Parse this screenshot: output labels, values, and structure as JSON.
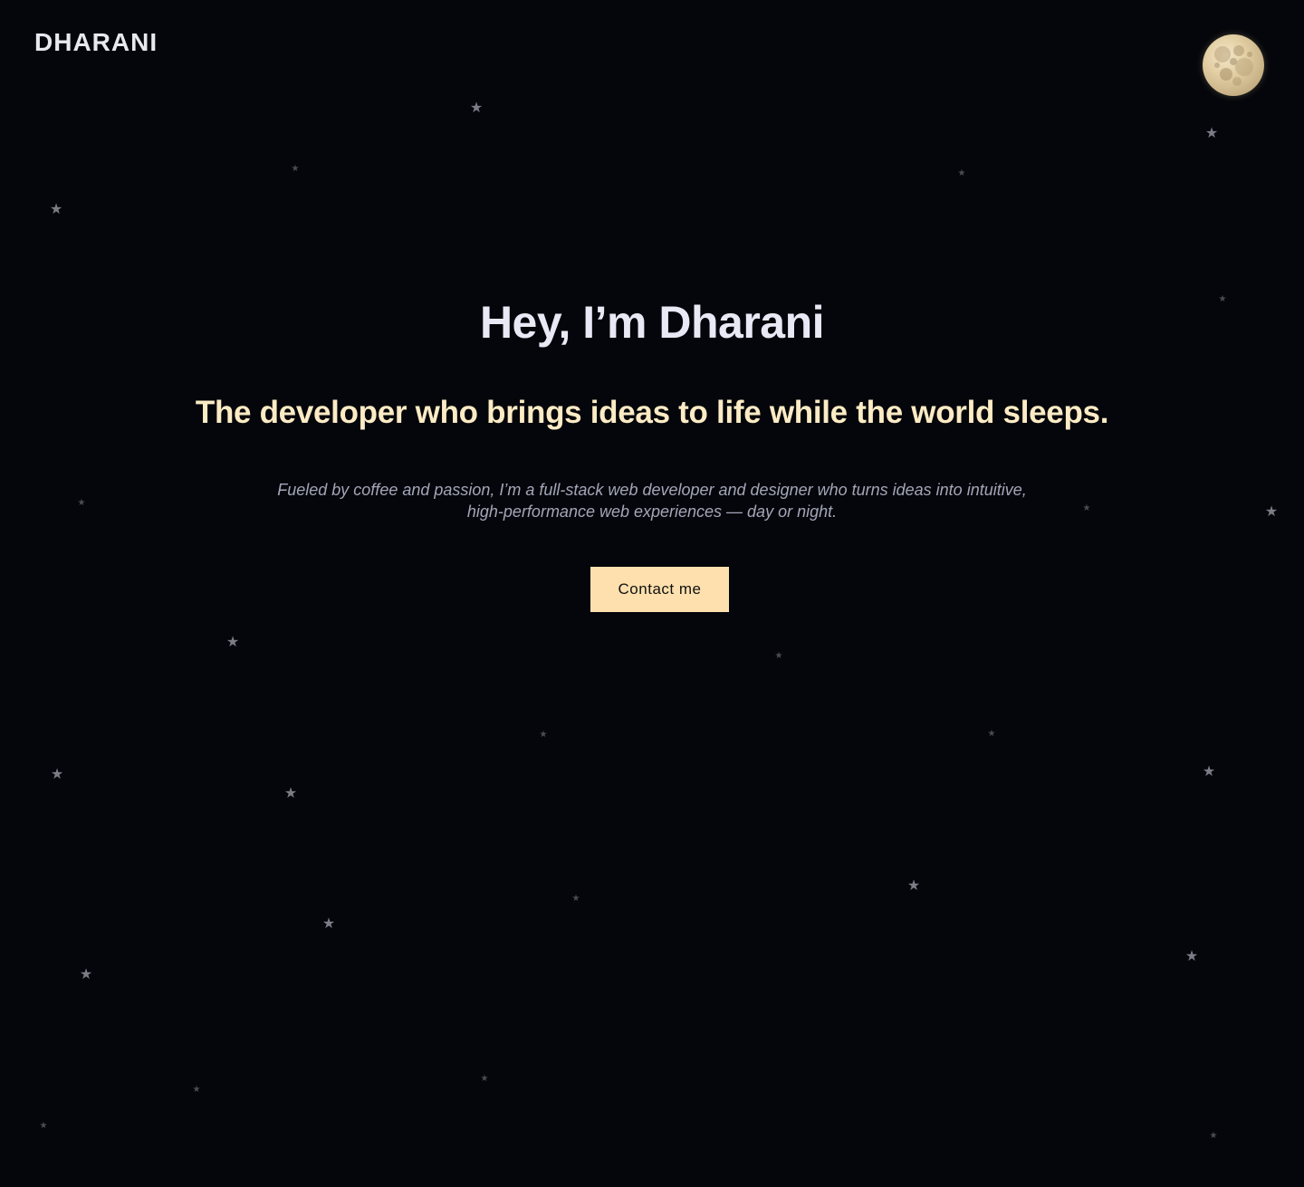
{
  "header": {
    "logo_text": "DHARANI",
    "theme_toggle_icon": "moon-icon"
  },
  "hero": {
    "title": "Hey, I’m Dharani",
    "tagline": "The developer who brings ideas to life while the world sleeps.",
    "description": "Fueled by coffee and passion, I’m a full-stack web developer and designer who turns ideas into intuitive, high-performance web experiences — day or night.",
    "cta_label": "Contact me"
  },
  "background": {
    "decoration_icon": "star-icon",
    "color": "#05060b"
  },
  "colors": {
    "title": "#e9e8f5",
    "tagline": "#fcebc4",
    "button_bg": "#fde0ad",
    "description": "#a3a6b8"
  }
}
